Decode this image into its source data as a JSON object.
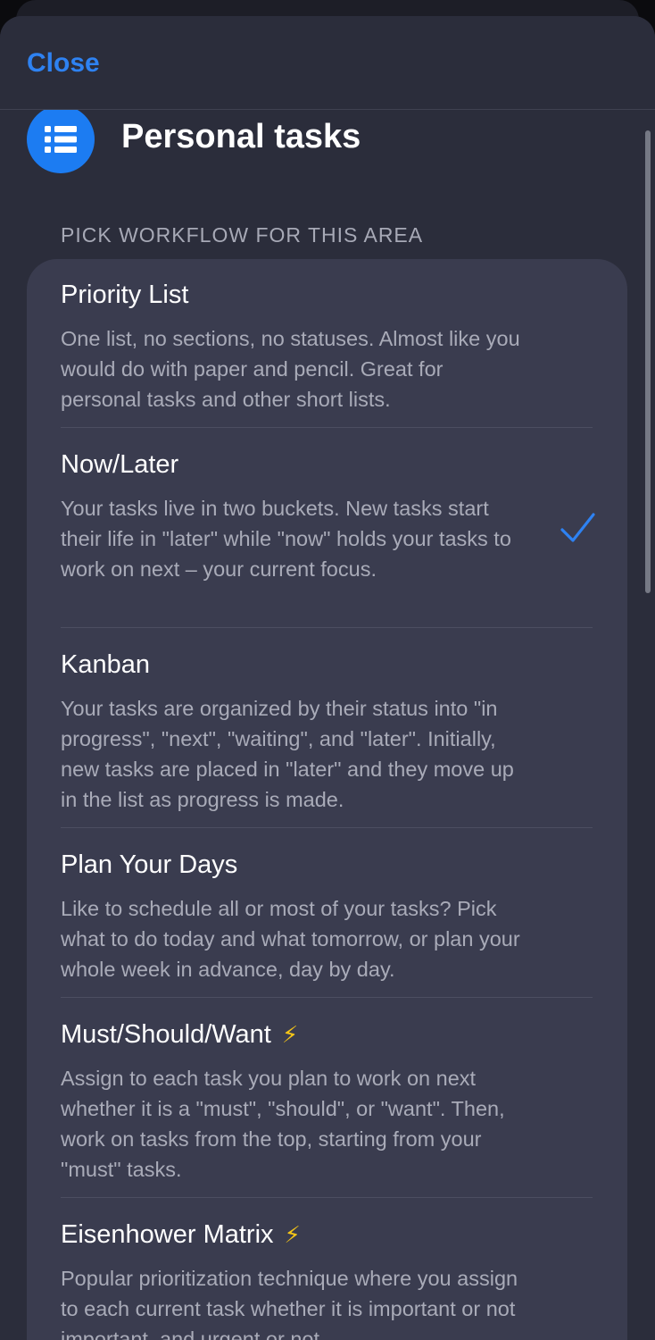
{
  "navbar": {
    "close_label": "Close"
  },
  "header": {
    "title": "Personal tasks",
    "icon": "list-icon"
  },
  "section_header": "PICK WORKFLOW FOR THIS AREA",
  "selected_option": "Now/Later",
  "accent_color": "#2e82f2",
  "options": [
    {
      "title": "Priority List",
      "desc": "One list, no sections, no statuses. Almost like you would do with paper and pencil. Great for personal tasks and other short lists."
    },
    {
      "title": "Now/Later",
      "desc": "Your tasks live in two buckets. New tasks start their life in \"later\" while \"now\" holds your tasks to work on next – your current focus."
    },
    {
      "title": "Kanban",
      "desc": "Your tasks are organized by their status into \"in progress\", \"next\", \"waiting\", and \"later\". Initially, new tasks are placed in \"later\" and they move up in the list as progress is made."
    },
    {
      "title": "Plan Your Days",
      "desc": "Like to schedule all or most of your tasks? Pick what to do today and what tomorrow, or plan your whole week in advance, day by day."
    },
    {
      "title": "Must/Should/Want",
      "badge": "⚡",
      "desc": "Assign to each task you plan to work on next whether it is a \"must\", \"should\", or \"want\". Then, work on tasks from the top, starting from your \"must\" tasks."
    },
    {
      "title": "Eisenhower Matrix",
      "badge": "⚡",
      "desc": "Popular prioritization technique where you assign to each current task whether it is important or not important, and urgent or not"
    }
  ]
}
